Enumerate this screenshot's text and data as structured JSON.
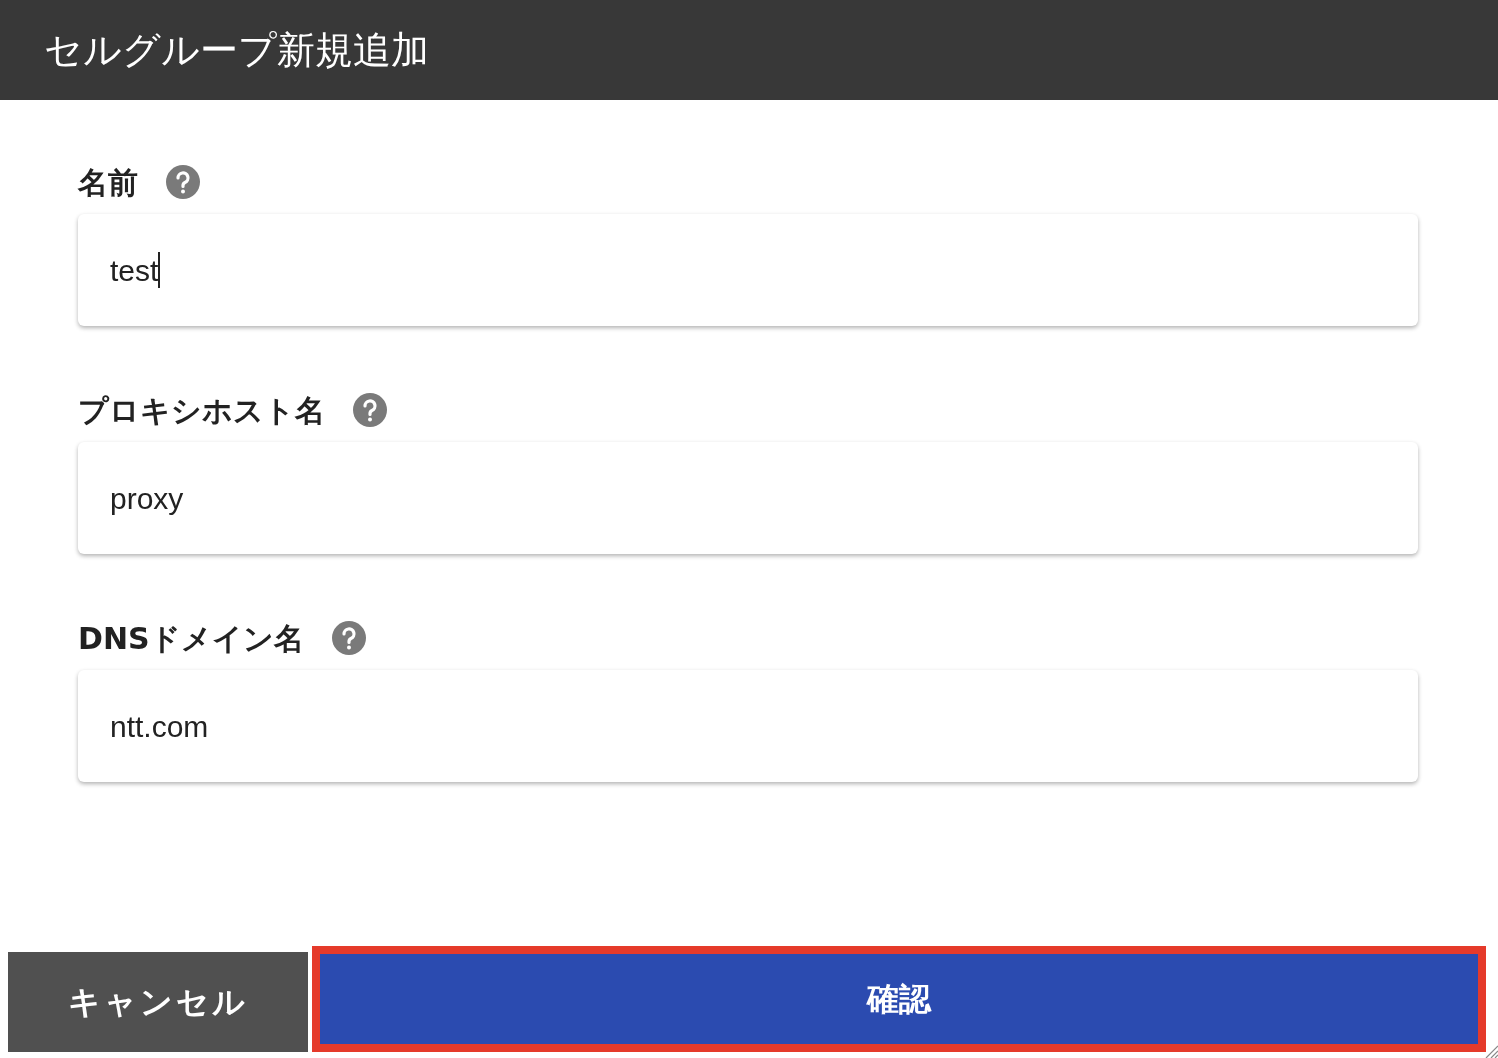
{
  "header": {
    "title": "セルグループ新規追加"
  },
  "fields": [
    {
      "label": "名前",
      "value": "test",
      "focused": true
    },
    {
      "label": "プロキシホスト名",
      "value": "proxy",
      "focused": false
    },
    {
      "label": "DNSドメイン名",
      "value": "ntt.com",
      "focused": false
    }
  ],
  "buttons": {
    "cancel": {
      "label": "キャンセル"
    },
    "confirm": {
      "label": "確認",
      "highlighted": true
    }
  }
}
